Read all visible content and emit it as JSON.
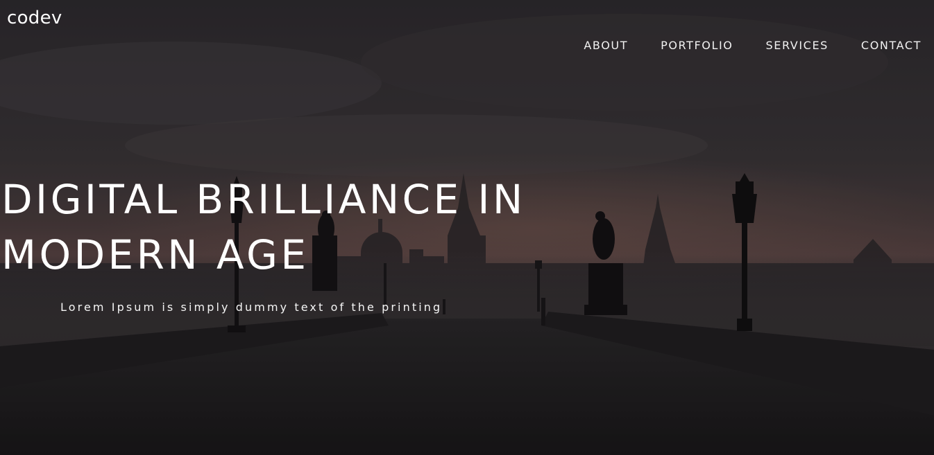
{
  "brand": {
    "logo_text": "codev"
  },
  "nav": {
    "items": [
      {
        "label": "ABOUT"
      },
      {
        "label": "PORTFOLIO"
      },
      {
        "label": "SERVICES"
      },
      {
        "label": "CONTACT"
      }
    ]
  },
  "hero": {
    "headline_line1": "DIGITAL BRILLIANCE IN",
    "headline_line2": "MODERN AGE",
    "tagline": "Lorem Ipsum is simply dummy text of the printing",
    "background_icon": "foggy-city-bridge-photo",
    "colors": {
      "sky_top": "#3a3538",
      "sky_glow": "#6a4f4a",
      "silhouette": "#1c1a1c",
      "text": "#ffffff"
    }
  }
}
